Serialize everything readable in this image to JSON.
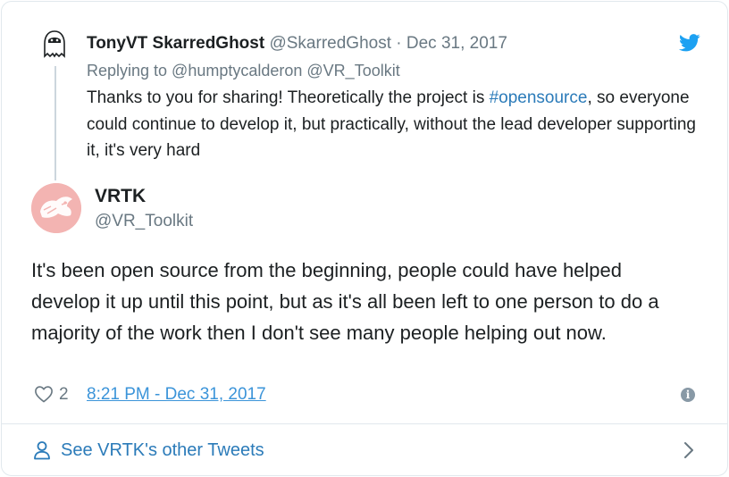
{
  "colors": {
    "link": "#2b7bb9",
    "timestamp_link": "#3b94d9",
    "secondary_text": "#697882",
    "primary_text": "#1c2022",
    "border": "#e1e8ed",
    "twitter_blue": "#1da1f2",
    "avatar_pink": "#f3b4b2"
  },
  "parent_tweet": {
    "display_name": "TonyVT SkarredGhost",
    "handle": "@SkarredGhost",
    "separator": "·",
    "date": "Dec 31, 2017",
    "replying_to": "Replying to @humptycalderon @VR_Toolkit",
    "text_before_hashtag": "Thanks to you for sharing! Theoretically the project is ",
    "hashtag": "#opensource",
    "text_after_hashtag": ", so everyone could continue to develop it, but practically, without the lead developer supporting it, it's very hard",
    "avatar_icon": "ghost-avatar-icon",
    "brand_icon": "twitter-bird-icon"
  },
  "main_tweet": {
    "display_name": "VRTK",
    "handle": "@VR_Toolkit",
    "avatar_icon": "vrtk-logo-avatar",
    "text": "It's been open source from the beginning, people could have helped develop it up until this point, but as it's all been left to one person to do a majority of the work then I don't see many people helping out now.",
    "like_count": "2",
    "timestamp": "8:21 PM - Dec 31, 2017",
    "info_icon_glyph": "i"
  },
  "footer": {
    "label": "See VRTK's other Tweets",
    "icons": [
      "person-icon",
      "chevron-right-icon"
    ]
  }
}
